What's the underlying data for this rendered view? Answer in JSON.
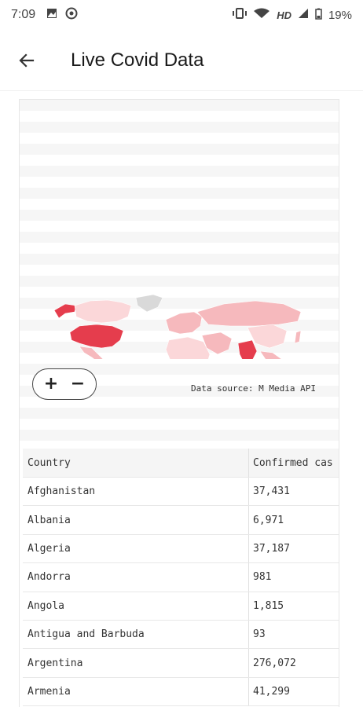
{
  "status_bar": {
    "time": "7:09",
    "battery": "19%",
    "network": "HD"
  },
  "app_bar": {
    "title": "Live Covid Data",
    "back_icon": "arrow-left-icon"
  },
  "map": {
    "zoom_in_label": "+",
    "zoom_out_label": "−",
    "source_text": "Data source: M Media API",
    "colors": {
      "highest": "#e53d4d",
      "high": "#f07a80",
      "medium": "#f6b9bd",
      "low": "#fbd7d9",
      "no_data": "#d9d9d9"
    }
  },
  "table": {
    "headers": {
      "country": "Country",
      "confirmed": "Confirmed cas"
    },
    "rows": [
      {
        "country": "Afghanistan",
        "confirmed": "37,431"
      },
      {
        "country": "Albania",
        "confirmed": "6,971"
      },
      {
        "country": "Algeria",
        "confirmed": "37,187"
      },
      {
        "country": "Andorra",
        "confirmed": "981"
      },
      {
        "country": "Angola",
        "confirmed": "1,815"
      },
      {
        "country": "Antigua and Barbuda",
        "confirmed": "93"
      },
      {
        "country": "Argentina",
        "confirmed": "276,072"
      },
      {
        "country": "Armenia",
        "confirmed": "41,299"
      }
    ]
  }
}
